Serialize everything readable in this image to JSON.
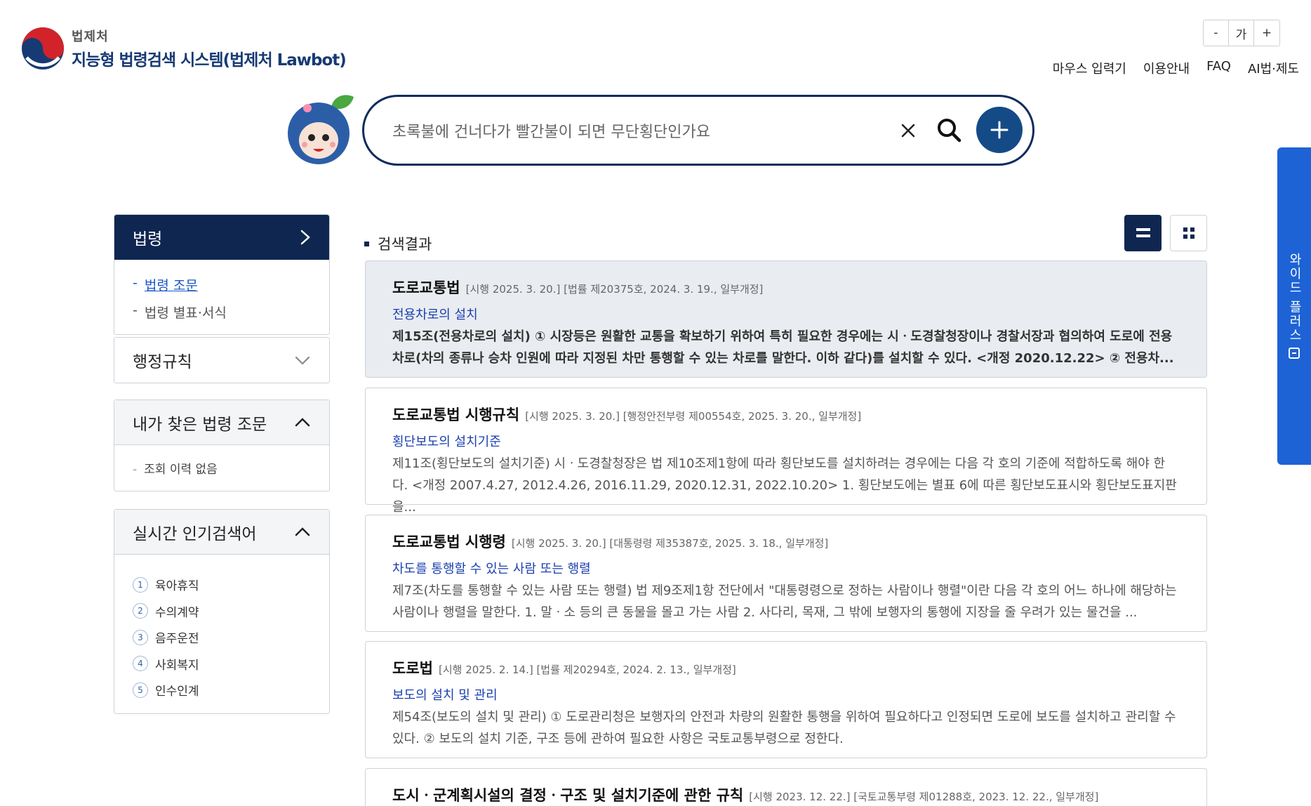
{
  "header": {
    "org": "법제처",
    "title": "지능형 법령검색 시스템(법제처 Lawbot)",
    "font_controls": [
      "-",
      "가",
      "+"
    ],
    "nav": [
      "마우스 입력기",
      "이용안내",
      "FAQ",
      "AI법·제도"
    ]
  },
  "search": {
    "query": "초록불에 건너다가 빨간불이 되면 무단횡단인가요",
    "clear_icon": "close-icon",
    "search_icon": "search-icon",
    "add_icon": "plus-icon"
  },
  "sidebar": {
    "law_panel": {
      "title": "법령",
      "items": [
        {
          "label": "법령 조문"
        },
        {
          "label": "법령 별표·서식"
        }
      ]
    },
    "admin_rules": {
      "title": "행정규칙"
    },
    "history": {
      "title": "내가 찾은 법령 조문",
      "empty": "조회 이력 없음"
    },
    "popular": {
      "title": "실시간 인기검색어",
      "items": [
        {
          "rank": "1",
          "term": "육아휴직"
        },
        {
          "rank": "2",
          "term": "수의계약"
        },
        {
          "rank": "3",
          "term": "음주운전"
        },
        {
          "rank": "4",
          "term": "사회복지"
        },
        {
          "rank": "5",
          "term": "인수인계"
        }
      ]
    }
  },
  "results": {
    "title": "검색결과",
    "items": [
      {
        "law": "도로교통법",
        "meta": "[시행 2025. 3. 20.] [법률 제20375호, 2024. 3. 19., 일부개정]",
        "article": "전용차로의 설치",
        "text": "제15조(전용차로의 설치) ① 시장등은 원활한 교통을 확보하기 위하여 특히 필요한 경우에는 시ㆍ도경찰청장이나 경찰서장과 협의하여 도로에 전용차로(차의 종류나 승차 인원에 따라 지정된 차만 통행할 수 있는 차로를 말한다. 이하 같다)를 설치할 수 있다. <개정 2020.12.22> ② 전용차..."
      },
      {
        "law": "도로교통법 시행규칙",
        "meta": "[시행 2025. 3. 20.] [행정안전부령 제00554호, 2025. 3. 20., 일부개정]",
        "article": "횡단보도의 설치기준",
        "text": "제11조(횡단보도의 설치기준) 시ㆍ도경찰청장은 법 제10조제1항에 따라 횡단보도를 설치하려는 경우에는 다음 각 호의 기준에 적합하도록 해야 한다. <개정 2007.4.27, 2012.4.26, 2016.11.29, 2020.12.31, 2022.10.20> 1. 횡단보도에는 별표 6에 따른 횡단보도표시와 횡단보도표지판을..."
      },
      {
        "law": "도로교통법 시행령",
        "meta": "[시행 2025. 3. 20.] [대통령령 제35387호, 2025. 3. 18., 일부개정]",
        "article": "차도를 통행할 수 있는 사람 또는 행렬",
        "text": "제7조(차도를 통행할 수 있는 사람 또는 행렬) 법 제9조제1항 전단에서 \"대통령령으로 정하는 사람이나 행렬\"이란 다음 각 호의 어느 하나에 해당하는 사람이나 행렬을 말한다. 1. 말ㆍ소 등의 큰 동물을 몰고 가는 사람 2. 사다리, 목재, 그 밖에 보행자의 통행에 지장을 줄 우려가 있는 물건을 ..."
      },
      {
        "law": "도로법",
        "meta": "[시행 2025. 2. 14.] [법률 제20294호, 2024. 2. 13., 일부개정]",
        "article": "보도의 설치 및 관리",
        "text": "제54조(보도의 설치 및 관리) ① 도로관리청은 보행자의 안전과 차량의 원활한 통행을 위하여 필요하다고 인정되면 도로에 보도를 설치하고 관리할 수 있다. ② 보도의 설치 기준, 구조 등에 관하여 필요한 사항은 국토교통부령으로 정한다."
      },
      {
        "law": "도시ㆍ군계획시설의 결정ㆍ구조 및 설치기준에 관한 규칙",
        "meta": "[시행 2023. 12. 22.] [국토교통부령 제01288호, 2023. 12. 22., 일부개정]",
        "article": "",
        "text": ""
      }
    ]
  },
  "side_tab": {
    "label": "와이드 플러스"
  },
  "colors": {
    "navy": "#0f2650",
    "accent": "#1d63d6",
    "link": "#1a3fb0"
  }
}
